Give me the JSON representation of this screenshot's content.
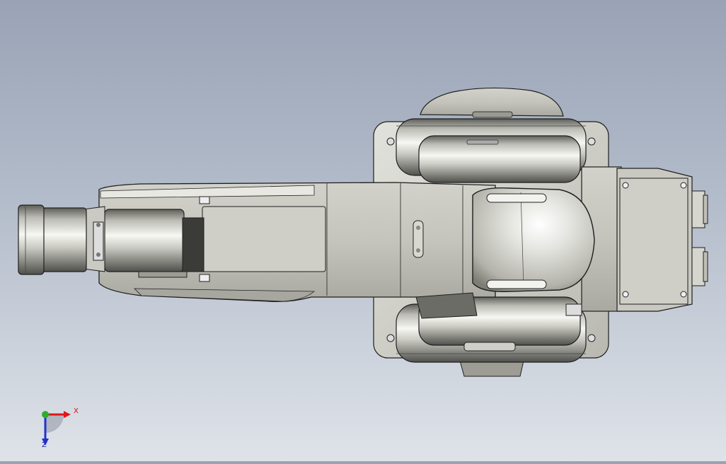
{
  "colors": {
    "background_top": "#99a3b5",
    "background_bottom": "#dfe3e9",
    "part_body": "#c8c8c0",
    "part_highlight": "#f6f6f2",
    "part_shadow": "#6f6f69",
    "edge": "#1e1e1e",
    "axis_x": "#e0161a",
    "axis_y": "#2bb02b",
    "axis_z": "#2233cc"
  },
  "triad": {
    "x_label": "X",
    "z_label": "Z",
    "y_label": ""
  },
  "icons": [
    "coordinate-triad-icon"
  ]
}
